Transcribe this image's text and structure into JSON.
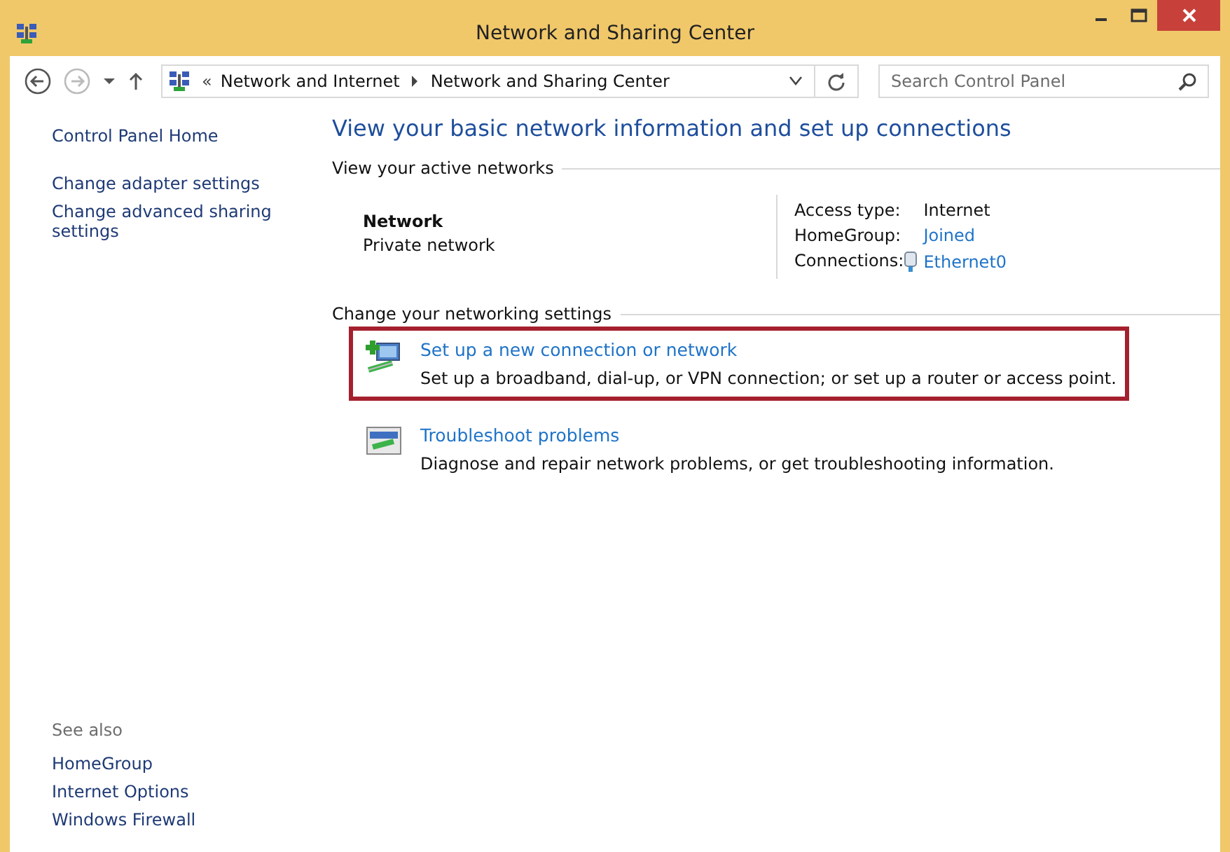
{
  "window": {
    "title": "Network and Sharing Center"
  },
  "address_bar": {
    "breadcrumbs": [
      "«",
      "Network and Internet",
      "Network and Sharing Center"
    ],
    "search": {
      "placeholder": "Search Control Panel"
    }
  },
  "sidebar": {
    "links": [
      "Control Panel Home",
      "Change adapter settings",
      "Change advanced sharing settings"
    ],
    "see_also": {
      "heading": "See also",
      "links": [
        "HomeGroup",
        "Internet Options",
        "Windows Firewall"
      ]
    }
  },
  "main": {
    "heading": "View your basic network information and set up connections",
    "active_networks": {
      "heading": "View your active networks",
      "name": "Network",
      "category": "Private network",
      "details": [
        {
          "label": "Access type:",
          "value": "Internet",
          "kind": "text"
        },
        {
          "label": "HomeGroup:",
          "value": "Joined",
          "kind": "link"
        },
        {
          "label": "Connections:",
          "value": "Ethernet0",
          "kind": "connection"
        }
      ]
    },
    "settings": {
      "heading": "Change your networking settings",
      "tasks": [
        {
          "title": "Set up a new connection or network",
          "description": "Set up a broadband, dial-up, or VPN connection; or set up a router or access point.",
          "kind": "setup",
          "highlighted": true
        },
        {
          "title": "Troubleshoot problems",
          "description": "Diagnose and repair network problems, or get troubleshooting information.",
          "kind": "troubleshoot",
          "highlighted": false
        }
      ]
    }
  }
}
